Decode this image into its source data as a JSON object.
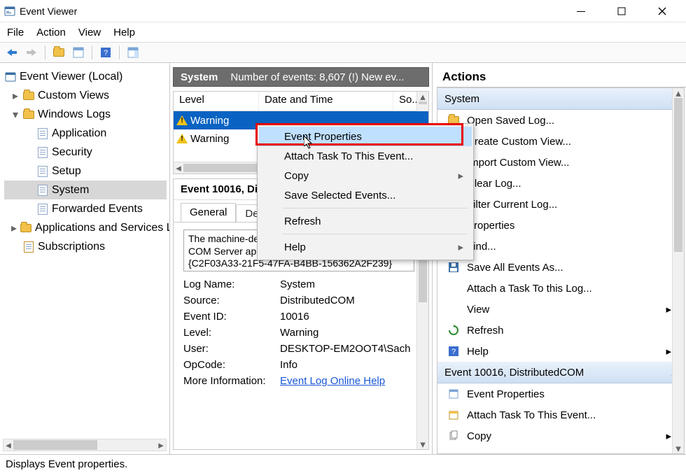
{
  "window": {
    "title": "Event Viewer"
  },
  "menus": {
    "file": "File",
    "action": "Action",
    "view": "View",
    "help": "Help"
  },
  "tree": {
    "root": "Event Viewer (Local)",
    "custom_views": "Custom Views",
    "windows_logs": "Windows Logs",
    "logs": {
      "application": "Application",
      "security": "Security",
      "setup": "Setup",
      "system": "System",
      "forwarded": "Forwarded Events"
    },
    "apps_services": "Applications and Services Logs",
    "subscriptions": "Subscriptions"
  },
  "center": {
    "header_bold": "System",
    "header_rest": "Number of events: 8,607 (!) New ev...",
    "cols": {
      "level": "Level",
      "date": "Date and Time",
      "source": "So..."
    },
    "rows": [
      {
        "level": "Warning",
        "selected": true
      },
      {
        "level": "Warning",
        "selected": false
      }
    ]
  },
  "details": {
    "title": "Event 10016, DistributedCOM",
    "tabs": {
      "general": "General",
      "details": "Details"
    },
    "desc_line1": "The machine-default permission settings do",
    "desc_line2": "COM Server application with CLSID",
    "desc_line3": "{C2F03A33-21F5-47FA-B4BB-156362A2F239}",
    "kv": {
      "log_name_k": "Log Name:",
      "log_name_v": "System",
      "source_k": "Source:",
      "source_v": "DistributedCOM",
      "event_id_k": "Event ID:",
      "event_id_v": "10016",
      "level_k": "Level:",
      "level_v": "Warning",
      "user_k": "User:",
      "user_v": "DESKTOP-EM2OOT4\\Sach",
      "opcode_k": "OpCode:",
      "opcode_v": "Info",
      "more_info_k": "More Information:",
      "more_info_v": "Event Log Online Help"
    }
  },
  "actions": {
    "header": "Actions",
    "group1": "System",
    "items1": [
      {
        "label": "Open Saved Log...",
        "icon": "folder"
      },
      {
        "label": "Create Custom View...",
        "icon": "funnel"
      },
      {
        "label": "Import Custom View...",
        "icon": "import"
      },
      {
        "label": "Clear Log...",
        "icon": ""
      },
      {
        "label": "Filter Current Log...",
        "icon": "funnel"
      },
      {
        "label": "Properties",
        "icon": "props"
      },
      {
        "label": "Find...",
        "icon": "find"
      },
      {
        "label": "Save All Events As...",
        "icon": "save"
      },
      {
        "label": "Attach a Task To this Log...",
        "icon": ""
      },
      {
        "label": "View",
        "icon": "",
        "submenu": true
      },
      {
        "label": "Refresh",
        "icon": "refresh"
      },
      {
        "label": "Help",
        "icon": "help",
        "submenu": true
      }
    ],
    "group2": "Event 10016, DistributedCOM",
    "items2": [
      {
        "label": "Event Properties",
        "icon": "props"
      },
      {
        "label": "Attach Task To This Event...",
        "icon": "task"
      },
      {
        "label": "Copy",
        "icon": "copy",
        "submenu": true
      }
    ]
  },
  "context_menu": {
    "items": [
      {
        "label": "Event Properties",
        "selected": true
      },
      {
        "label": "Attach Task To This Event..."
      },
      {
        "label": "Copy",
        "submenu": true
      },
      {
        "label": "Save Selected Events..."
      },
      {
        "sep": true
      },
      {
        "label": "Refresh"
      },
      {
        "sep": true
      },
      {
        "label": "Help",
        "submenu": true
      }
    ]
  },
  "status": "Displays Event properties."
}
